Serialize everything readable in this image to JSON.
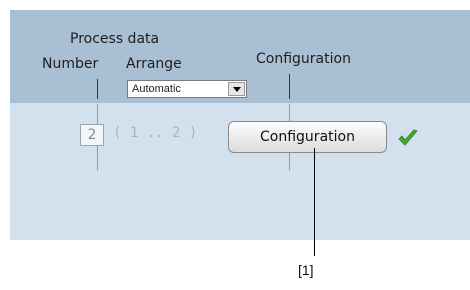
{
  "header": {
    "process_data_label": "Process data",
    "number_label": "Number",
    "arrange_label": "Arrange",
    "configuration_label": "Configuration"
  },
  "arrange_select": {
    "value": "Automatic"
  },
  "number_field": {
    "value": "2"
  },
  "range_text": "( 1 .. 2 )",
  "configuration_button": {
    "label": "Configuration"
  },
  "status": {
    "icon": "checkmark-icon",
    "color": "#3fae2a"
  },
  "callout": {
    "label": "[1]"
  },
  "colors": {
    "header_bg": "#a9bfd4",
    "body_bg": "#d3e1ee"
  }
}
